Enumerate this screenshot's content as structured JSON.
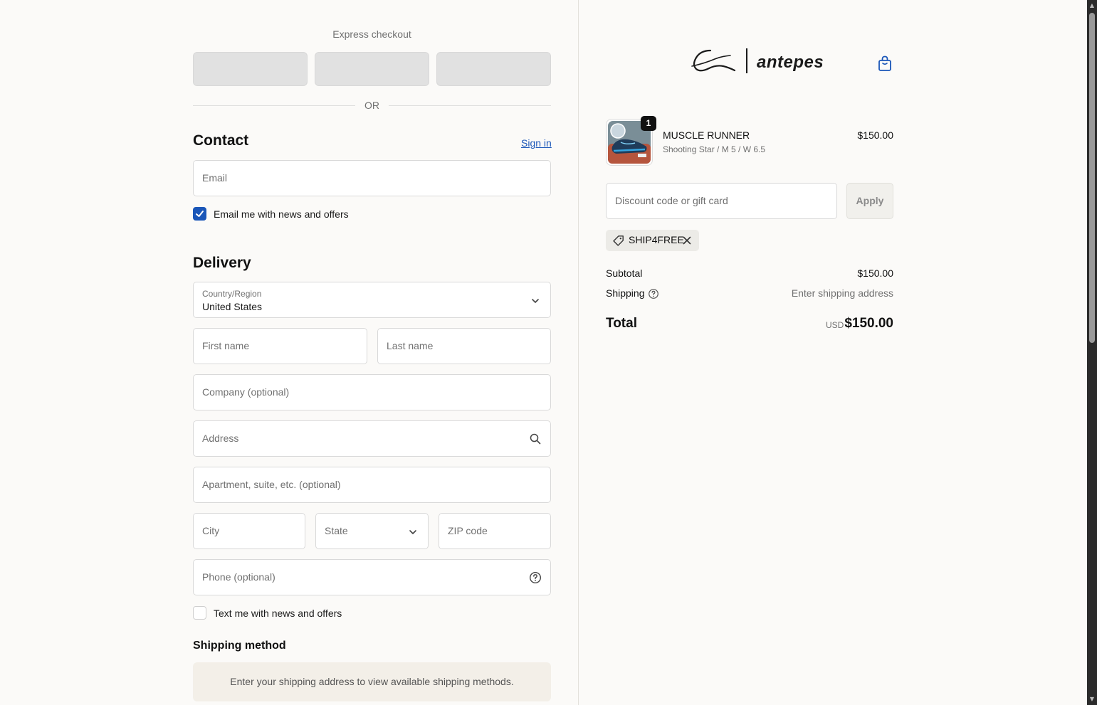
{
  "express": {
    "label": "Express checkout",
    "or": "OR"
  },
  "contact": {
    "title": "Contact",
    "signin": "Sign in",
    "email_placeholder": "Email",
    "newsletter_label": "Email me with news and offers",
    "newsletter_checked": true
  },
  "delivery": {
    "title": "Delivery",
    "country_label": "Country/Region",
    "country_value": "United States",
    "first_name": "First name",
    "last_name": "Last name",
    "company": "Company (optional)",
    "address": "Address",
    "apartment": "Apartment, suite, etc. (optional)",
    "city": "City",
    "state": "State",
    "zip": "ZIP code",
    "phone": "Phone (optional)",
    "sms_label": "Text me with news and offers",
    "sms_checked": false
  },
  "shipping_method": {
    "title": "Shipping method",
    "message": "Enter your shipping address to view available shipping methods."
  },
  "brand": {
    "name": "antepes"
  },
  "cart": {
    "item": {
      "name": "MUSCLE RUNNER",
      "variant": "Shooting Star / M 5 / W 6.5",
      "price": "$150.00",
      "quantity": "1"
    },
    "discount_placeholder": "Discount code or gift card",
    "apply_label": "Apply",
    "discount_code": "SHIP4FREE"
  },
  "summary": {
    "subtotal_label": "Subtotal",
    "subtotal_value": "$150.00",
    "shipping_label": "Shipping",
    "shipping_value": "Enter shipping address",
    "total_label": "Total",
    "currency": "USD",
    "total_value": "$150.00"
  },
  "colors": {
    "accent": "#1a56b8",
    "background": "#fbfaf8",
    "ship_box": "#f3efe8"
  }
}
